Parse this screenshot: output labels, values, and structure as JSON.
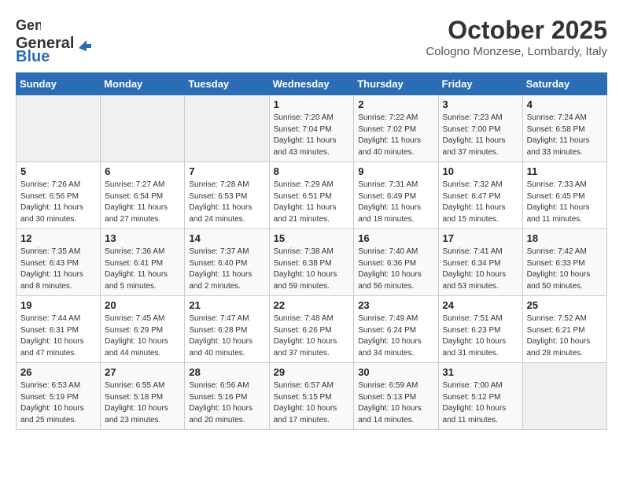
{
  "header": {
    "logo_general": "General",
    "logo_blue": "Blue",
    "month": "October 2025",
    "location": "Cologno Monzese, Lombardy, Italy"
  },
  "weekdays": [
    "Sunday",
    "Monday",
    "Tuesday",
    "Wednesday",
    "Thursday",
    "Friday",
    "Saturday"
  ],
  "weeks": [
    [
      {
        "day": "",
        "info": ""
      },
      {
        "day": "",
        "info": ""
      },
      {
        "day": "",
        "info": ""
      },
      {
        "day": "1",
        "info": "Sunrise: 7:20 AM\nSunset: 7:04 PM\nDaylight: 11 hours\nand 43 minutes."
      },
      {
        "day": "2",
        "info": "Sunrise: 7:22 AM\nSunset: 7:02 PM\nDaylight: 11 hours\nand 40 minutes."
      },
      {
        "day": "3",
        "info": "Sunrise: 7:23 AM\nSunset: 7:00 PM\nDaylight: 11 hours\nand 37 minutes."
      },
      {
        "day": "4",
        "info": "Sunrise: 7:24 AM\nSunset: 6:58 PM\nDaylight: 11 hours\nand 33 minutes."
      }
    ],
    [
      {
        "day": "5",
        "info": "Sunrise: 7:26 AM\nSunset: 6:56 PM\nDaylight: 11 hours\nand 30 minutes."
      },
      {
        "day": "6",
        "info": "Sunrise: 7:27 AM\nSunset: 6:54 PM\nDaylight: 11 hours\nand 27 minutes."
      },
      {
        "day": "7",
        "info": "Sunrise: 7:28 AM\nSunset: 6:53 PM\nDaylight: 11 hours\nand 24 minutes."
      },
      {
        "day": "8",
        "info": "Sunrise: 7:29 AM\nSunset: 6:51 PM\nDaylight: 11 hours\nand 21 minutes."
      },
      {
        "day": "9",
        "info": "Sunrise: 7:31 AM\nSunset: 6:49 PM\nDaylight: 11 hours\nand 18 minutes."
      },
      {
        "day": "10",
        "info": "Sunrise: 7:32 AM\nSunset: 6:47 PM\nDaylight: 11 hours\nand 15 minutes."
      },
      {
        "day": "11",
        "info": "Sunrise: 7:33 AM\nSunset: 6:45 PM\nDaylight: 11 hours\nand 11 minutes."
      }
    ],
    [
      {
        "day": "12",
        "info": "Sunrise: 7:35 AM\nSunset: 6:43 PM\nDaylight: 11 hours\nand 8 minutes."
      },
      {
        "day": "13",
        "info": "Sunrise: 7:36 AM\nSunset: 6:41 PM\nDaylight: 11 hours\nand 5 minutes."
      },
      {
        "day": "14",
        "info": "Sunrise: 7:37 AM\nSunset: 6:40 PM\nDaylight: 11 hours\nand 2 minutes."
      },
      {
        "day": "15",
        "info": "Sunrise: 7:38 AM\nSunset: 6:38 PM\nDaylight: 10 hours\nand 59 minutes."
      },
      {
        "day": "16",
        "info": "Sunrise: 7:40 AM\nSunset: 6:36 PM\nDaylight: 10 hours\nand 56 minutes."
      },
      {
        "day": "17",
        "info": "Sunrise: 7:41 AM\nSunset: 6:34 PM\nDaylight: 10 hours\nand 53 minutes."
      },
      {
        "day": "18",
        "info": "Sunrise: 7:42 AM\nSunset: 6:33 PM\nDaylight: 10 hours\nand 50 minutes."
      }
    ],
    [
      {
        "day": "19",
        "info": "Sunrise: 7:44 AM\nSunset: 6:31 PM\nDaylight: 10 hours\nand 47 minutes."
      },
      {
        "day": "20",
        "info": "Sunrise: 7:45 AM\nSunset: 6:29 PM\nDaylight: 10 hours\nand 44 minutes."
      },
      {
        "day": "21",
        "info": "Sunrise: 7:47 AM\nSunset: 6:28 PM\nDaylight: 10 hours\nand 40 minutes."
      },
      {
        "day": "22",
        "info": "Sunrise: 7:48 AM\nSunset: 6:26 PM\nDaylight: 10 hours\nand 37 minutes."
      },
      {
        "day": "23",
        "info": "Sunrise: 7:49 AM\nSunset: 6:24 PM\nDaylight: 10 hours\nand 34 minutes."
      },
      {
        "day": "24",
        "info": "Sunrise: 7:51 AM\nSunset: 6:23 PM\nDaylight: 10 hours\nand 31 minutes."
      },
      {
        "day": "25",
        "info": "Sunrise: 7:52 AM\nSunset: 6:21 PM\nDaylight: 10 hours\nand 28 minutes."
      }
    ],
    [
      {
        "day": "26",
        "info": "Sunrise: 6:53 AM\nSunset: 5:19 PM\nDaylight: 10 hours\nand 25 minutes."
      },
      {
        "day": "27",
        "info": "Sunrise: 6:55 AM\nSunset: 5:18 PM\nDaylight: 10 hours\nand 23 minutes."
      },
      {
        "day": "28",
        "info": "Sunrise: 6:56 AM\nSunset: 5:16 PM\nDaylight: 10 hours\nand 20 minutes."
      },
      {
        "day": "29",
        "info": "Sunrise: 6:57 AM\nSunset: 5:15 PM\nDaylight: 10 hours\nand 17 minutes."
      },
      {
        "day": "30",
        "info": "Sunrise: 6:59 AM\nSunset: 5:13 PM\nDaylight: 10 hours\nand 14 minutes."
      },
      {
        "day": "31",
        "info": "Sunrise: 7:00 AM\nSunset: 5:12 PM\nDaylight: 10 hours\nand 11 minutes."
      },
      {
        "day": "",
        "info": ""
      }
    ]
  ]
}
